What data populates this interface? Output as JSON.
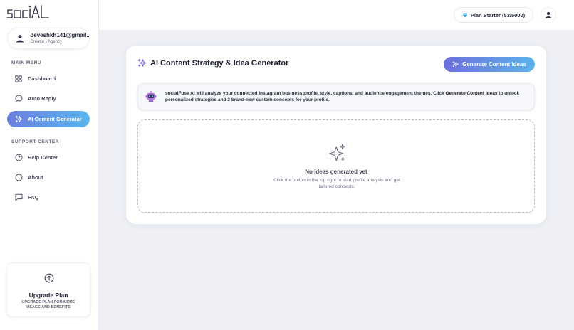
{
  "logo": {
    "text": "social"
  },
  "user": {
    "email": "deveshkh141@gmail...",
    "role": "Creator \\ Agency"
  },
  "sidebar": {
    "main_menu_label": "MAIN MENU",
    "main_items": [
      {
        "label": "Dashboard",
        "icon": "grid-icon"
      },
      {
        "label": "Auto Reply",
        "icon": "chat-icon"
      },
      {
        "label": "AI Content Generator",
        "icon": "sparkles-icon",
        "active": true
      }
    ],
    "support_label": "SUPPORT CENTER",
    "support_items": [
      {
        "label": "Help Center",
        "icon": "question-icon"
      },
      {
        "label": "About",
        "icon": "info-icon"
      },
      {
        "label": "FAQ",
        "icon": "message-icon"
      }
    ]
  },
  "upgrade": {
    "title": "Upgrade Plan",
    "subtitle": "UPGRADE PLAN FOR MORE USAGE AND BENEFITS"
  },
  "topbar": {
    "plan_label": "Plan Starter (53/5000)"
  },
  "main": {
    "title": "AI Content Strategy & Idea Generator",
    "generate_label": "Generate Content Ideas",
    "info": {
      "prefix": "socialFuse AI will analyze your connected Instagram business profile, style, captions, and audience engagement themes. Click ",
      "highlight": "Generate Content Ideas",
      "suffix": " to unlock personalized strategies and 3 brand-new custom concepts for your profile."
    },
    "empty": {
      "title": "No ideas generated yet",
      "subtitle": "Click the button in the top right to start profile analysis and get tailored concepts."
    }
  },
  "colors": {
    "accent_start": "#6b7fe0",
    "accent_end": "#59b6ec"
  }
}
